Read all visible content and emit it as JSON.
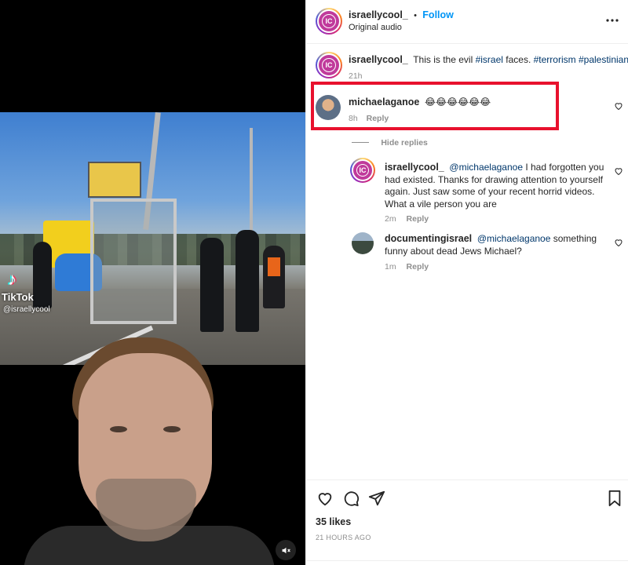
{
  "media": {
    "watermark_brand": "TikTok",
    "watermark_handle": "@israellycool",
    "mute_icon": "speaker-muted-icon"
  },
  "header": {
    "username": "israellycool_",
    "separator": "•",
    "follow_label": "Follow",
    "audio": "Original audio",
    "more_icon": "more-horizontal-icon"
  },
  "caption": {
    "username": "israellycool_",
    "text_before": "This is the evil ",
    "tag1": "#israel",
    "text_mid": " faces. ",
    "tag2": "#terrorism",
    "tag3": "#palestinian",
    "time": "21h"
  },
  "comments": [
    {
      "username": "michaelaganoe",
      "text": "😂😂😂😂😂😂",
      "time": "8h",
      "reply_label": "Reply"
    }
  ],
  "replies_toggle": "Hide replies",
  "replies": [
    {
      "username": "israellycool_",
      "mention": "@michaelaganoe",
      "text": " I had forgotten you had existed. Thanks for drawing attention to yourself again. Just saw some of your recent horrid videos. What a vile person you are",
      "time": "2m",
      "reply_label": "Reply"
    },
    {
      "username": "documentingisrael",
      "mention": "@michaelaganoe",
      "text": " something funny about dead Jews Michael?",
      "time": "1m",
      "reply_label": "Reply"
    }
  ],
  "actions": {
    "likes": "35 likes",
    "timestamp": "21 HOURS AGO"
  },
  "colors": {
    "accent": "#0095f6",
    "highlight_box": "#e8112d",
    "hashtag": "#00376b"
  }
}
